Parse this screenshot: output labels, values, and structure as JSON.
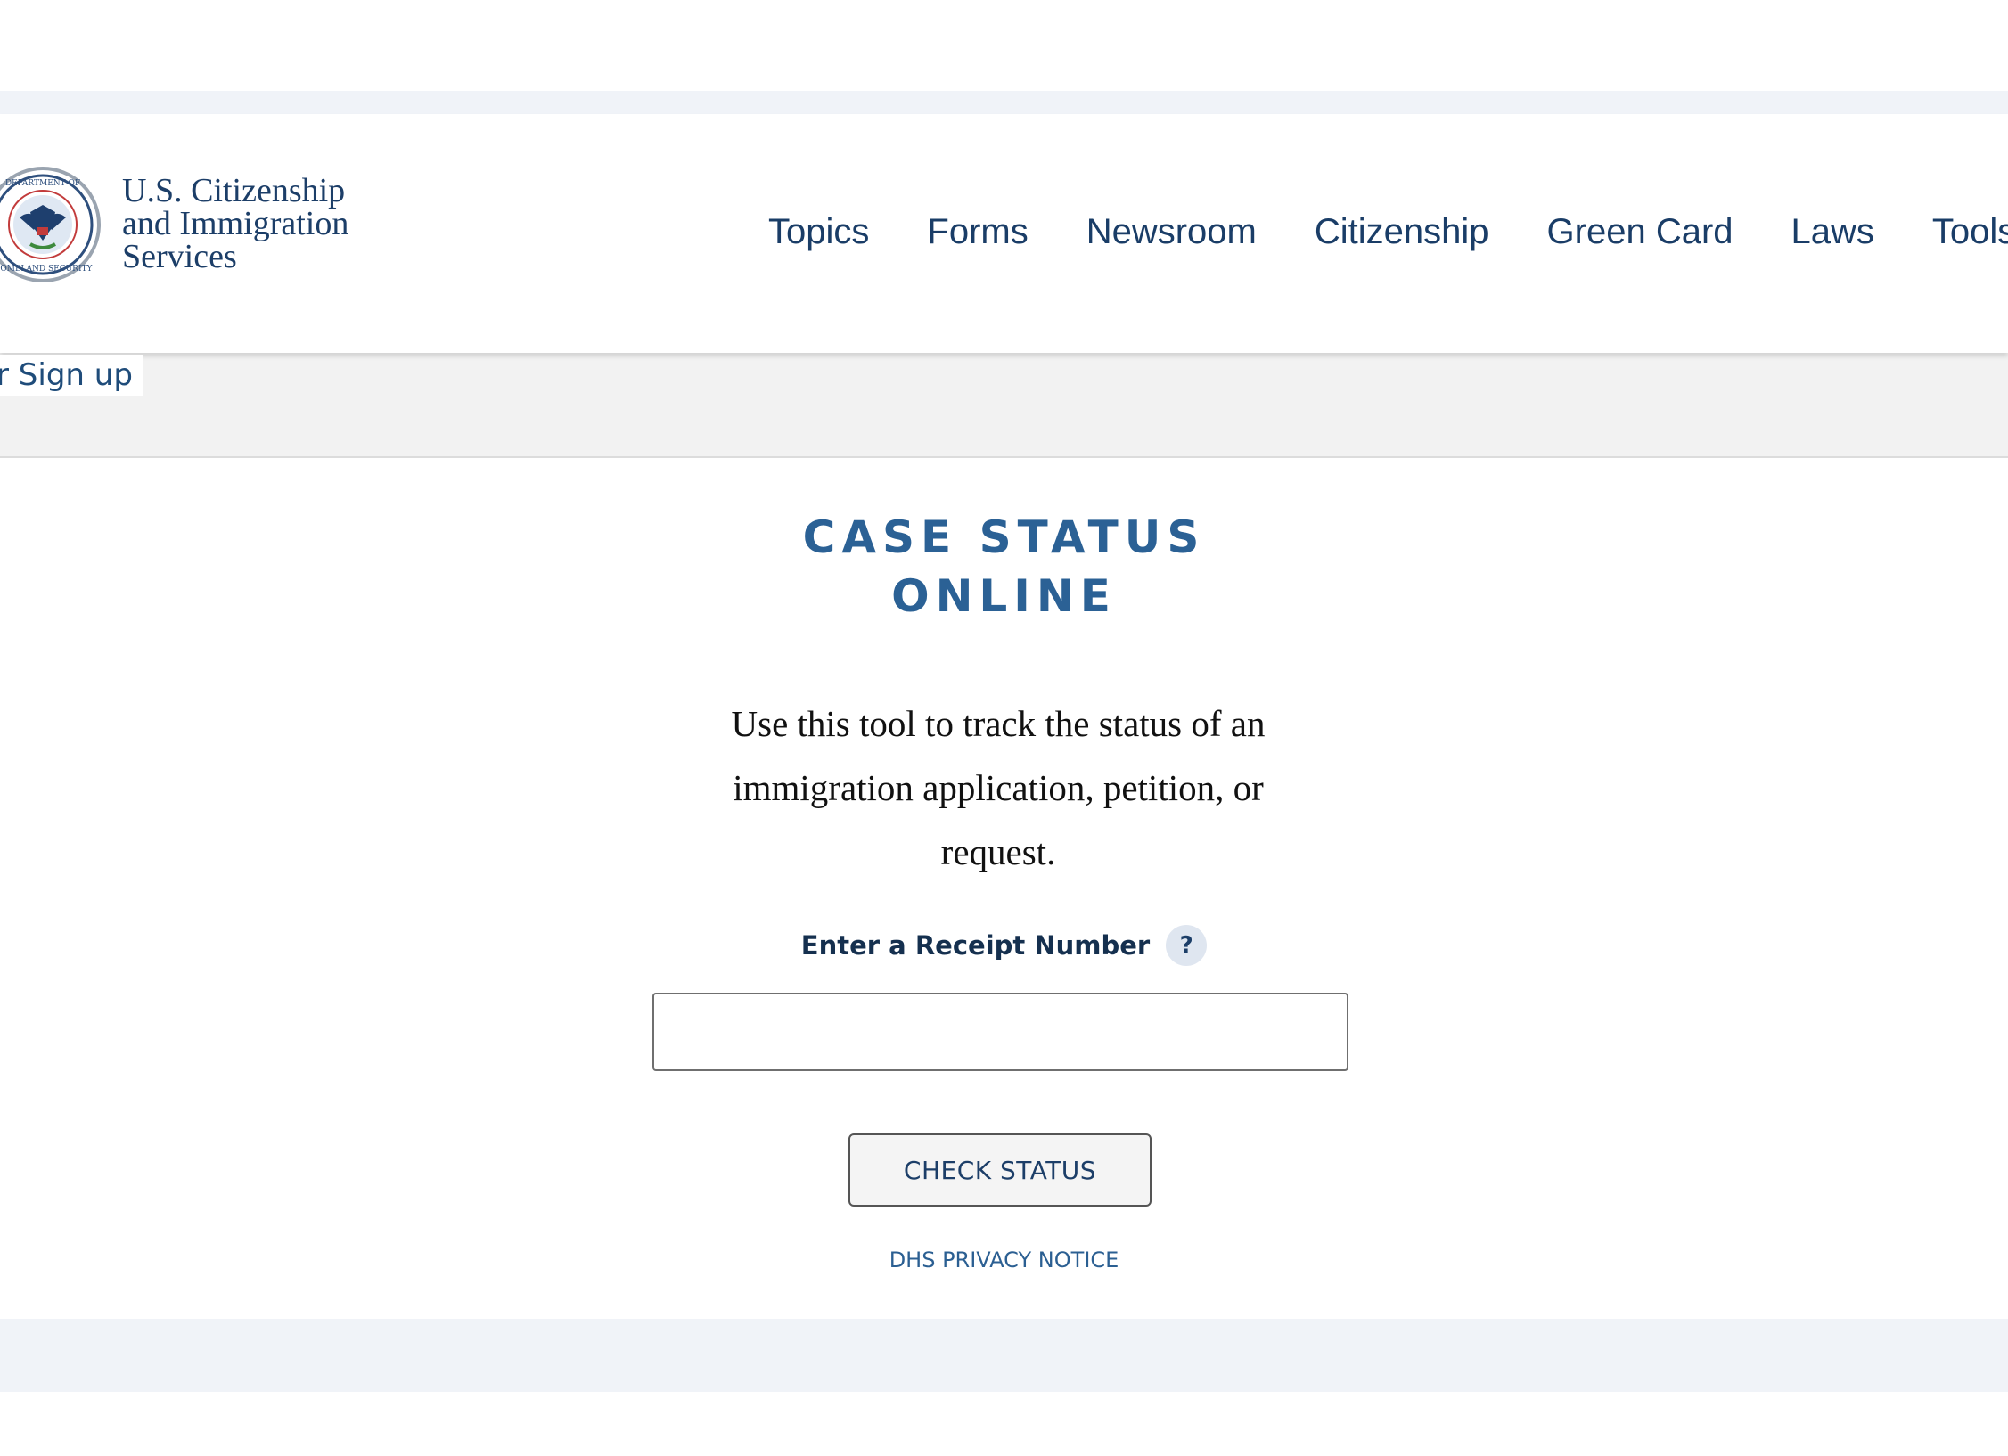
{
  "header": {
    "agency_name_lines": [
      "U.S. Citizenship",
      "and Immigration",
      "Services"
    ],
    "seal_icon": "dhs-seal-icon",
    "nav": [
      {
        "label": "Topics"
      },
      {
        "label": "Forms"
      },
      {
        "label": "Newsroom"
      },
      {
        "label": "Citizenship"
      },
      {
        "label": "Green Card"
      },
      {
        "label": "Laws"
      },
      {
        "label": "Tools"
      }
    ]
  },
  "account_bar": {
    "signup_label": "Sign up",
    "leading_fragment": "r"
  },
  "main": {
    "title_lines": [
      "CASE STATUS",
      "ONLINE"
    ],
    "intro": "Use this tool to track the status of an immigration application, petition, or request.",
    "receipt_label": "Enter a Receipt Number",
    "help_icon_glyph": "?",
    "receipt_value": "",
    "receipt_placeholder": "",
    "check_button": "CHECK STATUS",
    "privacy_link": "DHS PRIVACY NOTICE"
  },
  "colors": {
    "brand_navy": "#1c3e68",
    "title_blue": "#2b6195",
    "band_gray": "#f2f2f2",
    "band_light_blue": "#f0f3f8"
  }
}
